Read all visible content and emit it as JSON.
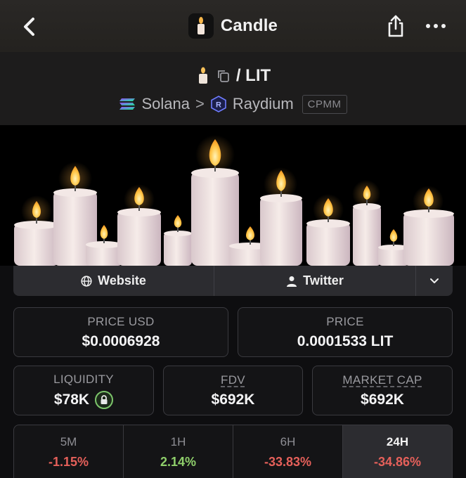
{
  "header": {
    "title": "Candle",
    "back_icon": "chevron-left-icon",
    "share_icon": "share-icon",
    "more_icon": "more-horizontal-icon"
  },
  "pair": {
    "symbol": "/ LIT",
    "chain": "Solana",
    "separator": ">",
    "dex": "Raydium",
    "dex_type": "CPMM"
  },
  "links": {
    "website": "Website",
    "twitter": "Twitter"
  },
  "stats": {
    "price_usd_label": "PRICE USD",
    "price_usd": "$0.0006928",
    "price_label": "PRICE",
    "price": "0.0001533 LIT",
    "liquidity_label": "LIQUIDITY",
    "liquidity": "$78K",
    "fdv_label": "FDV",
    "fdv": "$692K",
    "mcap_label": "MARKET CAP",
    "mcap": "$692K"
  },
  "timeframes": [
    {
      "label": "5M",
      "value": "-1.15%",
      "color": "#e5605a"
    },
    {
      "label": "1H",
      "value": "2.14%",
      "color": "#8fcf6b"
    },
    {
      "label": "6H",
      "value": "-33.83%",
      "color": "#e5605a"
    },
    {
      "label": "24H",
      "value": "-34.86%",
      "color": "#e5605a",
      "active": true
    }
  ],
  "colors": {
    "positive": "#8fcf6b",
    "negative": "#e5605a",
    "lock_ring": "#7cc46a"
  }
}
